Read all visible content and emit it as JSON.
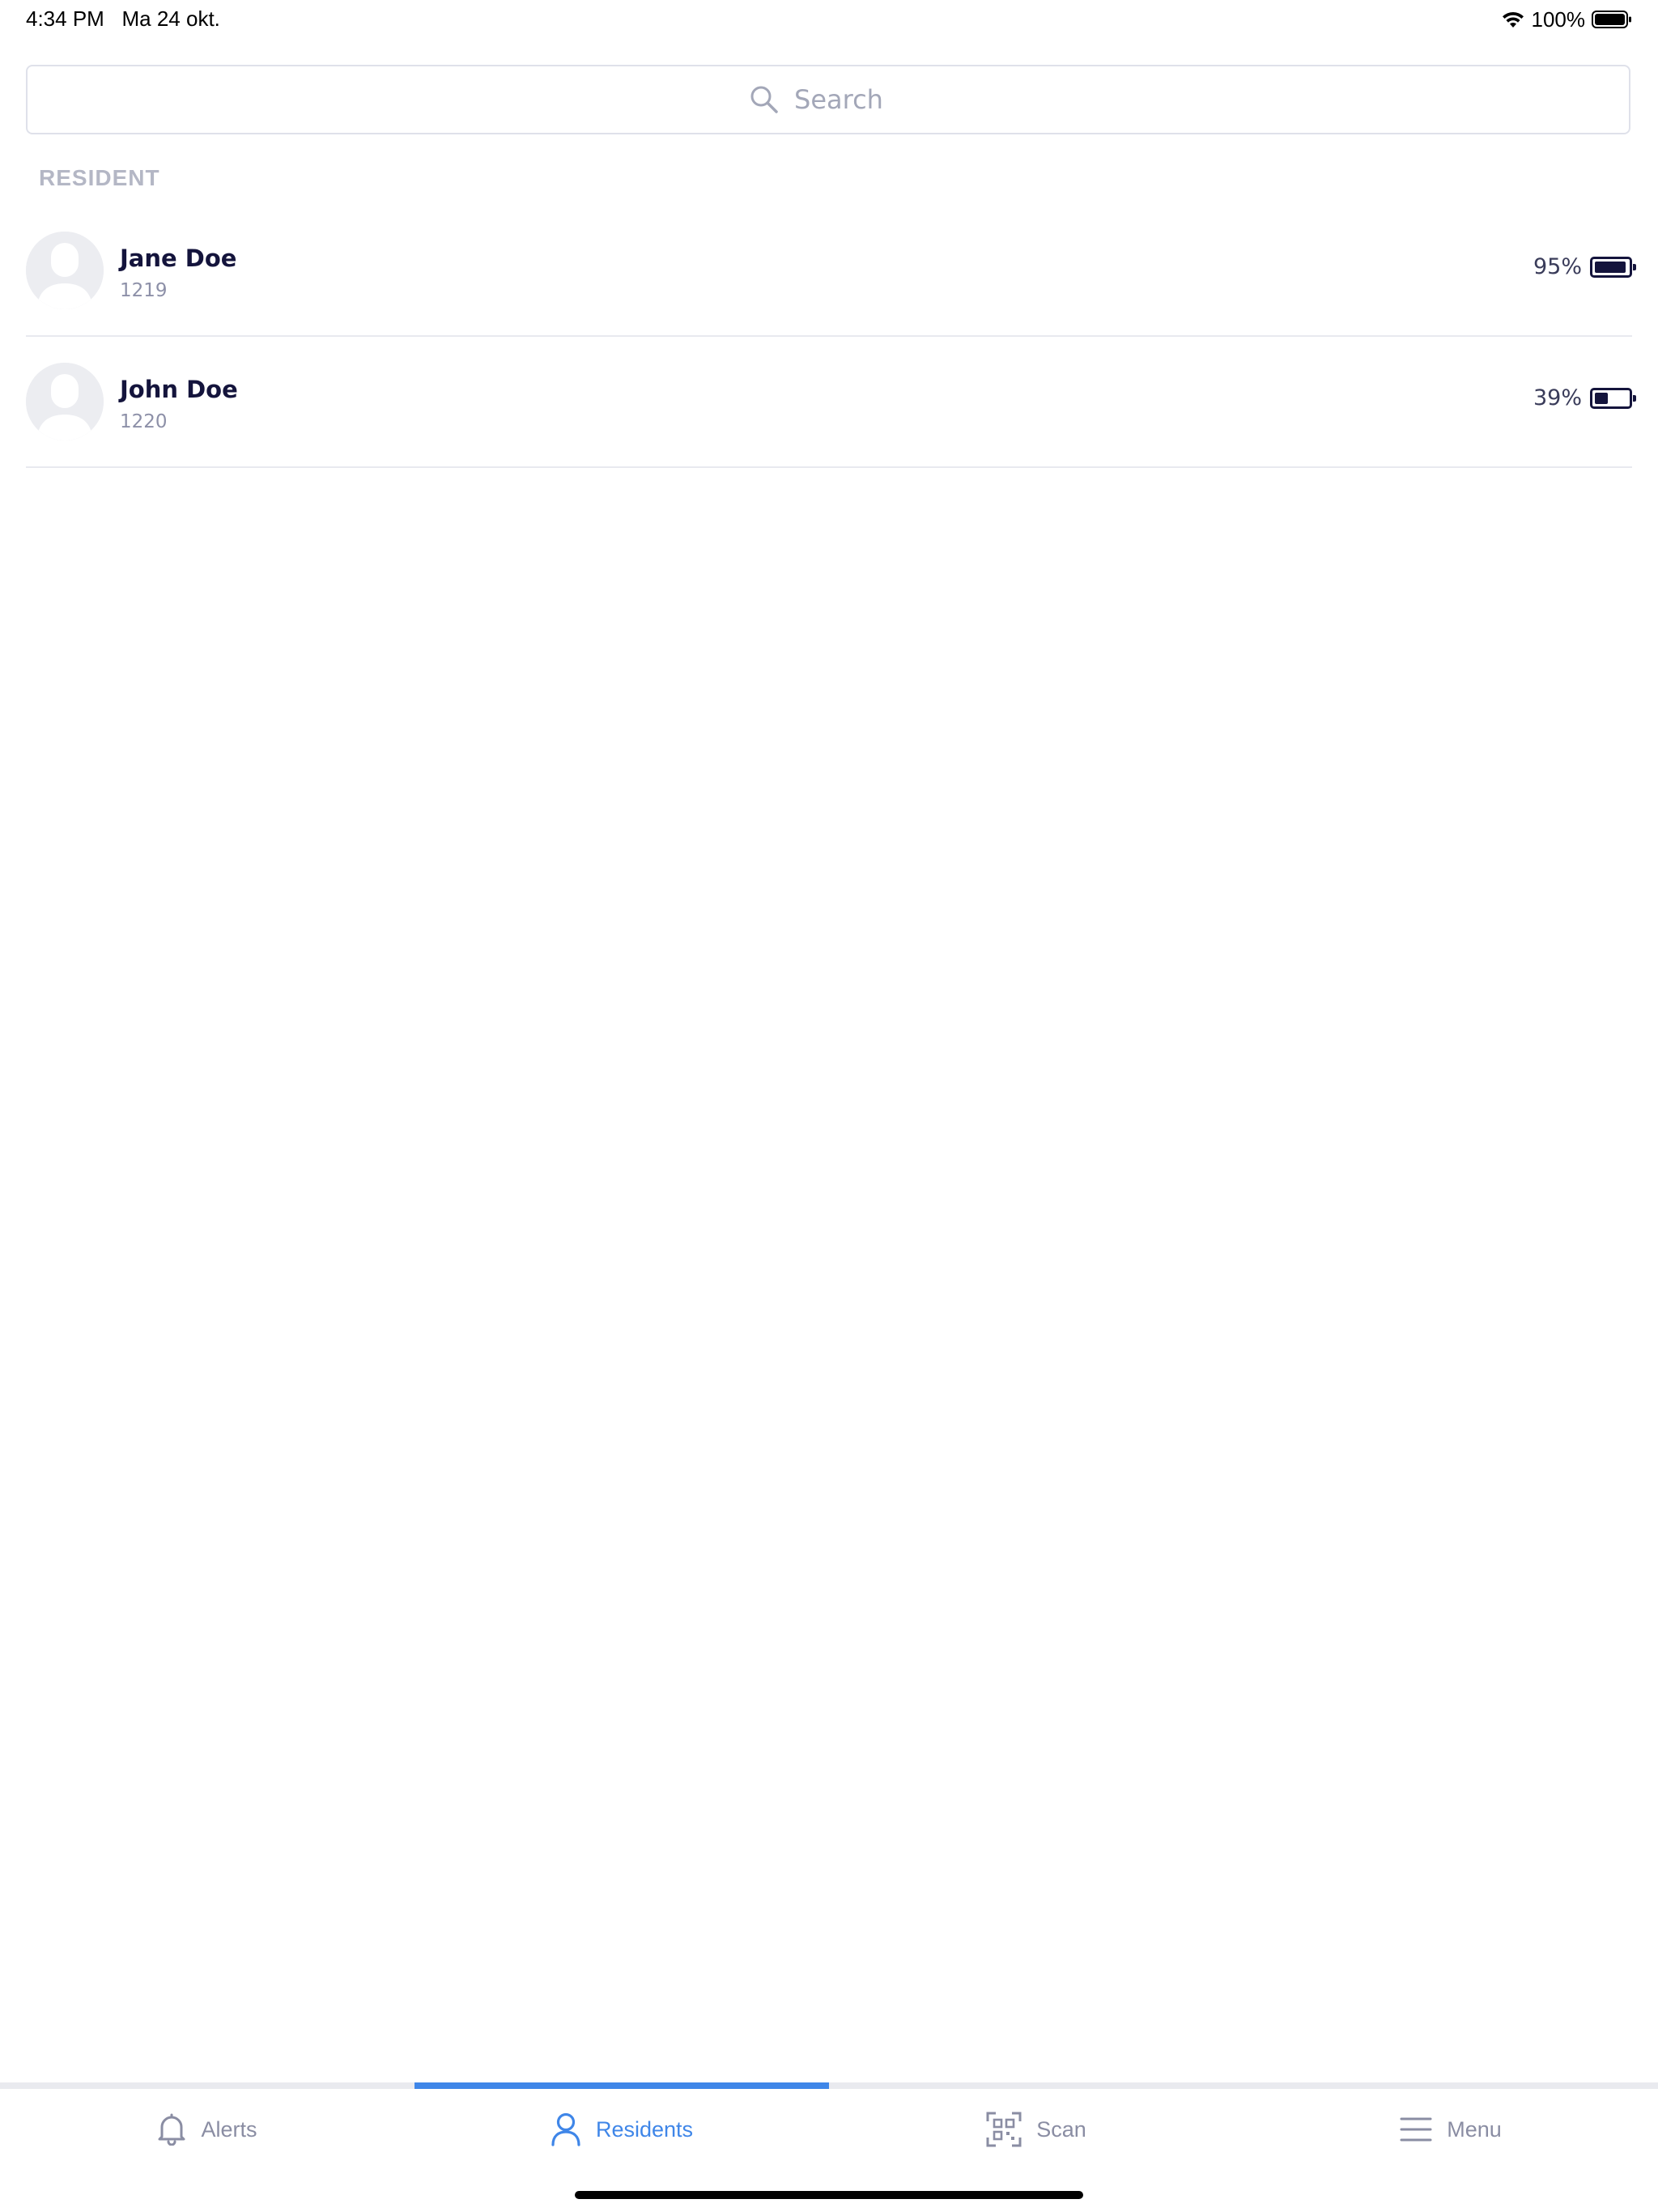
{
  "status_bar": {
    "time": "4:34 PM   Ma 24 okt.",
    "battery": "100%"
  },
  "search": {
    "placeholder": "Search"
  },
  "section": {
    "title": "RESIDENT"
  },
  "residents": [
    {
      "name": "Jane Doe",
      "id": "1219",
      "battery": "95%",
      "battery_level": 0.95
    },
    {
      "name": "John Doe",
      "id": "1220",
      "battery": "39%",
      "battery_level": 0.39
    }
  ],
  "tabs": [
    {
      "label": "Alerts",
      "icon": "bell-icon",
      "active": false
    },
    {
      "label": "Residents",
      "icon": "person-icon",
      "active": true
    },
    {
      "label": "Scan",
      "icon": "qr-scan-icon",
      "active": false
    },
    {
      "label": "Menu",
      "icon": "hamburger-menu-icon",
      "active": false
    }
  ],
  "colors": {
    "accent": "#3f86e8",
    "text_dark": "#14143c",
    "muted": "#8a8da3"
  }
}
